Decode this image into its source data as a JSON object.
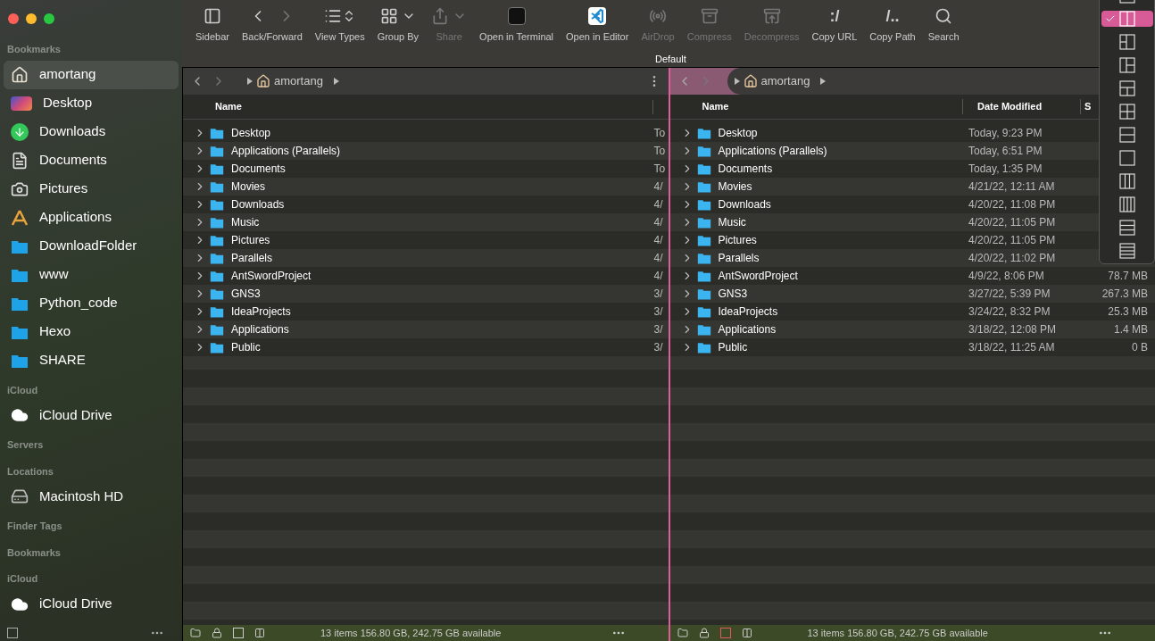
{
  "toolbar": {
    "items": [
      {
        "kind": "sidebar",
        "label": "Sidebar",
        "disabled": false
      },
      {
        "kind": "backforward",
        "label": "Back/Forward",
        "disabled": false
      },
      {
        "kind": "viewtypes",
        "label": "View Types",
        "disabled": false
      },
      {
        "kind": "groupby",
        "label": "Group By",
        "disabled": false
      },
      {
        "kind": "share",
        "label": "Share",
        "disabled": true
      },
      {
        "kind": "terminal",
        "label": "Open in Terminal",
        "disabled": false
      },
      {
        "kind": "editor",
        "label": "Open in Editor",
        "disabled": false
      },
      {
        "kind": "airdrop",
        "label": "AirDrop",
        "disabled": true
      },
      {
        "kind": "compress",
        "label": "Compress",
        "disabled": true
      },
      {
        "kind": "decompress",
        "label": "Decompress",
        "disabled": true
      },
      {
        "kind": "glyph",
        "glyph": ":/",
        "label": "Copy URL",
        "disabled": false
      },
      {
        "kind": "glyph",
        "glyph": "/..",
        "label": "Copy Path",
        "disabled": false
      },
      {
        "kind": "search",
        "label": "Search",
        "disabled": false
      }
    ],
    "group_label": "Default"
  },
  "sidebar": {
    "sections": [
      {
        "title": "Bookmarks",
        "items": [
          {
            "kind": "home",
            "label": "amortang",
            "selected": true
          },
          {
            "kind": "desktop",
            "label": "Desktop",
            "selected": false
          },
          {
            "kind": "downloads",
            "label": "Downloads",
            "selected": false
          },
          {
            "kind": "documents",
            "label": "Documents",
            "selected": false
          },
          {
            "kind": "camera",
            "label": "Pictures",
            "selected": false
          },
          {
            "kind": "applications",
            "label": "Applications",
            "selected": false
          },
          {
            "kind": "folder",
            "label": "DownloadFolder",
            "selected": false
          },
          {
            "kind": "folder",
            "label": "www",
            "selected": false
          },
          {
            "kind": "folder",
            "label": "Python_code",
            "selected": false
          },
          {
            "kind": "folder",
            "label": "Hexo",
            "selected": false
          },
          {
            "kind": "folder",
            "label": "SHARE",
            "selected": false
          }
        ]
      },
      {
        "title": "iCloud",
        "items": [
          {
            "kind": "cloud",
            "label": "iCloud Drive",
            "selected": false
          }
        ]
      },
      {
        "title": "Servers"
      },
      {
        "title": "Locations",
        "items": [
          {
            "kind": "disk",
            "label": "Macintosh HD",
            "selected": false
          }
        ]
      },
      {
        "title": "Finder Tags"
      },
      {
        "title": "Bookmarks"
      },
      {
        "title": "iCloud",
        "items": [
          {
            "kind": "cloud",
            "label": "iCloud Drive",
            "selected": false
          }
        ]
      }
    ]
  },
  "panes": [
    {
      "active": false,
      "path": "amortang",
      "columns": [
        "Name"
      ],
      "status": "13 items 156.80 GB, 242.75 GB available",
      "rows": [
        {
          "name": "Desktop",
          "date": "To"
        },
        {
          "name": "Applications (Parallels)",
          "date": "To"
        },
        {
          "name": "Documents",
          "date": "To"
        },
        {
          "name": "Movies",
          "date": "4/"
        },
        {
          "name": "Downloads",
          "date": "4/"
        },
        {
          "name": "Music",
          "date": "4/"
        },
        {
          "name": "Pictures",
          "date": "4/"
        },
        {
          "name": "Parallels",
          "date": "4/"
        },
        {
          "name": "AntSwordProject",
          "date": "4/"
        },
        {
          "name": "GNS3",
          "date": "3/"
        },
        {
          "name": "IdeaProjects",
          "date": "3/"
        },
        {
          "name": "Applications",
          "date": "3/"
        },
        {
          "name": "Public",
          "date": "3/"
        }
      ]
    },
    {
      "active": true,
      "path": "amortang",
      "columns": [
        "Name",
        "Date Modified",
        "S"
      ],
      "status": "13 items 156.80 GB, 242.75 GB available",
      "rows": [
        {
          "name": "Desktop",
          "date": "Today, 9:23 PM"
        },
        {
          "name": "Applications (Parallels)",
          "date": "Today, 6:51 PM"
        },
        {
          "name": "Documents",
          "date": "Today, 1:35 PM"
        },
        {
          "name": "Movies",
          "date": "4/21/22, 12:11 AM"
        },
        {
          "name": "Downloads",
          "date": "4/20/22, 11:08 PM"
        },
        {
          "name": "Music",
          "date": "4/20/22, 11:05 PM"
        },
        {
          "name": "Pictures",
          "date": "4/20/22, 11:05 PM"
        },
        {
          "name": "Parallels",
          "date": "4/20/22, 11:02 PM"
        },
        {
          "name": "AntSwordProject",
          "date": "4/9/22, 8:06 PM",
          "size": "78.7 MB"
        },
        {
          "name": "GNS3",
          "date": "3/27/22, 5:39 PM",
          "size": "267.3 MB"
        },
        {
          "name": "IdeaProjects",
          "date": "3/24/22, 8:32 PM",
          "size": "25.3 MB"
        },
        {
          "name": "Applications",
          "date": "3/18/22, 12:08 PM",
          "size": "1.4 MB"
        },
        {
          "name": "Public",
          "date": "3/18/22, 11:25 AM",
          "size": "0 B"
        }
      ]
    }
  ],
  "layout_menu": {
    "items": [
      {
        "kind": "top2",
        "selected": false
      },
      {
        "kind": "cols2",
        "selected": true
      },
      {
        "kind": "left2",
        "selected": false
      },
      {
        "kind": "right2",
        "selected": false
      },
      {
        "kind": "top3",
        "selected": false
      },
      {
        "kind": "grid4",
        "selected": false
      },
      {
        "kind": "rows2",
        "selected": false
      },
      {
        "kind": "single",
        "selected": false
      },
      {
        "kind": "cols3",
        "selected": false
      },
      {
        "kind": "cols4",
        "selected": false
      },
      {
        "kind": "rows3",
        "selected": false
      },
      {
        "kind": "rows4",
        "selected": false
      }
    ]
  }
}
